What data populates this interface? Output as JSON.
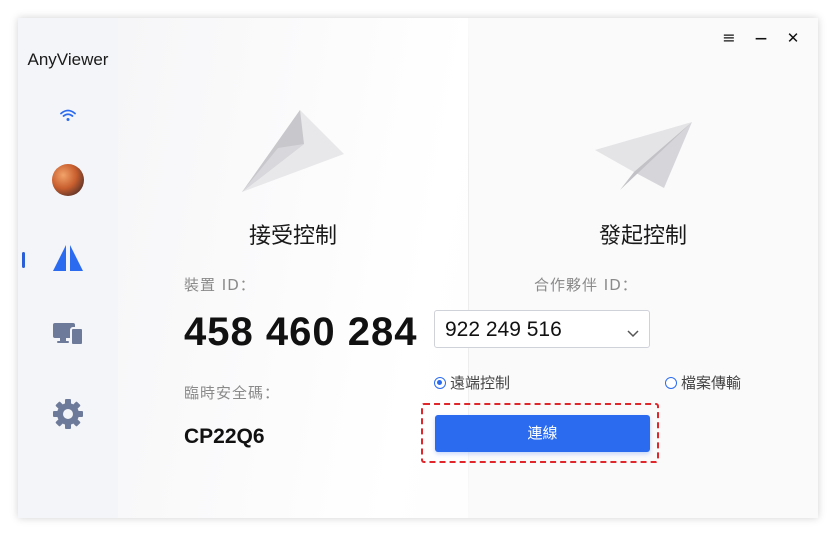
{
  "app": {
    "name": "AnyViewer"
  },
  "window_controls": {
    "menu": "≡",
    "minimize": "—",
    "close": "✕"
  },
  "sidebar": {
    "items": [
      {
        "icon": "wifi-icon"
      },
      {
        "icon": "avatar"
      },
      {
        "icon": "remote-control-icon",
        "active": true
      },
      {
        "icon": "devices-icon"
      },
      {
        "icon": "gear-icon"
      }
    ]
  },
  "accept_control": {
    "title": "接受控制",
    "device_id_label": "裝置 ID：",
    "device_id": "458 460 284",
    "temp_code_label": "臨時安全碼：",
    "temp_code": "CP22Q6"
  },
  "initiate_control": {
    "title": "發起控制",
    "partner_id_label": "合作夥伴 ID：",
    "partner_id_value": "922 249 516",
    "options": [
      {
        "label": "遠端控制",
        "checked": true
      },
      {
        "label": "檔案傳輸",
        "checked": false
      }
    ],
    "connect_label": "連線"
  },
  "colors": {
    "accent": "#2b6bf0",
    "highlight_border": "#e0262a",
    "sidebar_bg": "#f4f5f8"
  }
}
